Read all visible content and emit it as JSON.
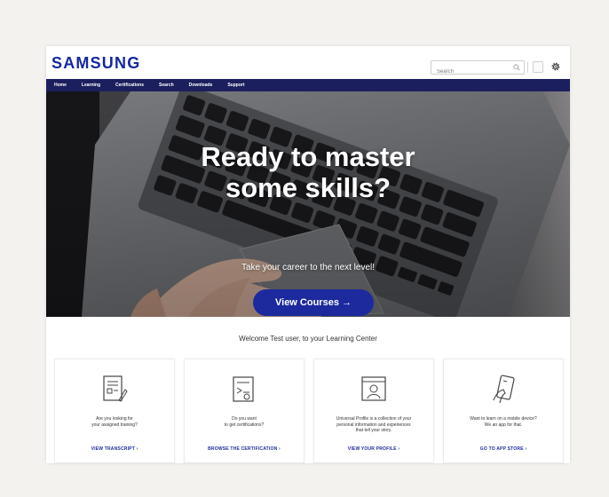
{
  "header": {
    "logo": "SAMSUNG",
    "search_placeholder": "Search"
  },
  "nav": {
    "items": [
      "Home",
      "Learning",
      "Certifications",
      "Search",
      "Downloads",
      "Support"
    ]
  },
  "hero": {
    "title_line1": "Ready to master",
    "title_line2": "some skills?",
    "subtitle": "Take your career to the next level!",
    "cta_label": "View Courses →"
  },
  "welcome": "Welcome Test user, to your Learning Center",
  "cards": [
    {
      "icon": "transcript-icon",
      "text_line1": "Are you looking for",
      "text_line2": "your assigned training?",
      "text_line3": "",
      "link": "VIEW TRANSCRIPT ›"
    },
    {
      "icon": "certificate-icon",
      "text_line1": "Do you want",
      "text_line2": "to get certifications?",
      "text_line3": "",
      "link": "BROWSE THE CERTIFICATION ›"
    },
    {
      "icon": "profile-icon",
      "text_line1": "Universal Profile is a collection of your",
      "text_line2": "personal information and experiences",
      "text_line3": "that tell your story.",
      "link": "VIEW YOUR PROFILE ›"
    },
    {
      "icon": "mobile-app-icon",
      "text_line1": "Want to learn on a mobile device?",
      "text_line2": "We an app for that.",
      "text_line3": "",
      "link": "GO TO APP STORE ›"
    }
  ],
  "colors": {
    "brand": "#1428a0",
    "nav_bg": "#1c1f5e",
    "cta_bg": "#1c2a9e",
    "page_bg": "#f4f2ef"
  }
}
